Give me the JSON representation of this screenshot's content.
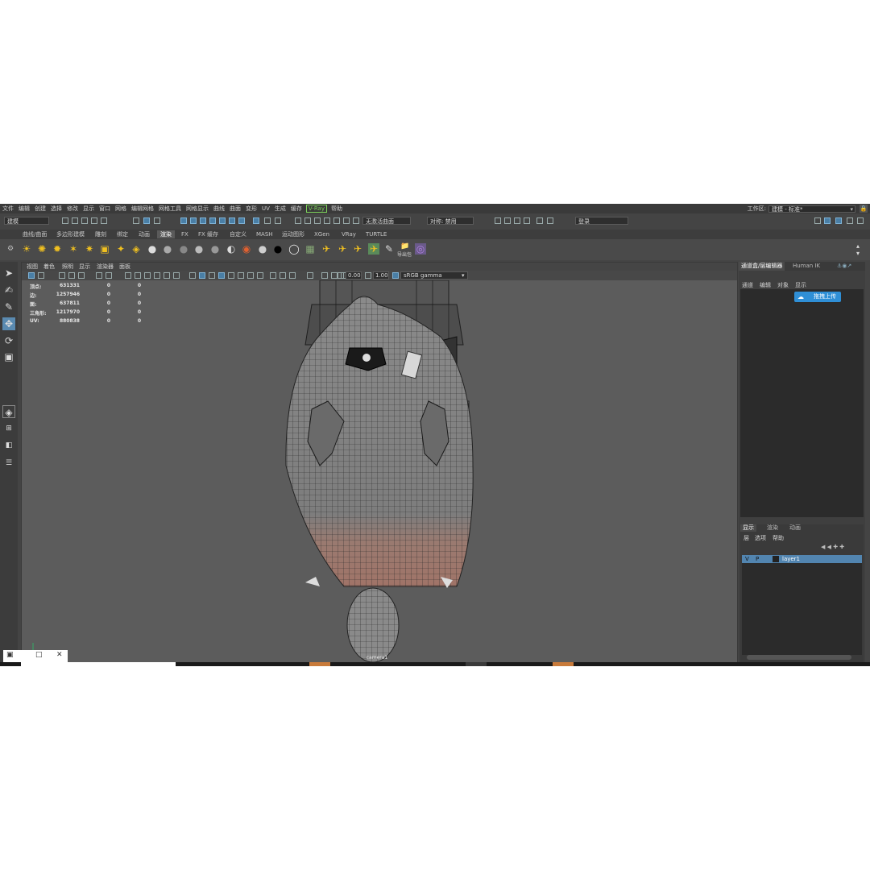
{
  "menu": [
    "文件",
    "编辑",
    "创建",
    "选择",
    "修改",
    "显示",
    "窗口",
    "网格",
    "编辑网格",
    "网格工具",
    "网格显示",
    "曲线",
    "曲面",
    "变形",
    "UV",
    "生成",
    "缓存",
    "V-Ray",
    "帮助"
  ],
  "workspace": {
    "label": "工作区:",
    "value": "建模 - 标准*"
  },
  "status": {
    "mode": "建模",
    "live_surface": "无激活曲面",
    "symmetry": "对称: 禁用",
    "login": "登录"
  },
  "shelf_tabs": [
    "曲线/曲面",
    "多边形建模",
    "雕刻",
    "绑定",
    "动画",
    "渲染",
    "FX",
    "FX 缓存",
    "自定义",
    "MASH",
    "运动图形",
    "XGen",
    "VRay",
    "TURTLE"
  ],
  "shelf_active_tab": "渲染",
  "shelf_label": "导出包",
  "viewport": {
    "menu": [
      "视图",
      "着色",
      "照明",
      "显示",
      "渲染器",
      "面板"
    ],
    "exposure": "0.00",
    "gamma": "1.00",
    "color_space": "sRGB gamma",
    "camera_label": "camera1",
    "hud": [
      {
        "label": "顶点:",
        "v1": "631331",
        "v2": "0",
        "v3": "0"
      },
      {
        "label": "边:",
        "v1": "1257946",
        "v2": "0",
        "v3": "0"
      },
      {
        "label": "面:",
        "v1": "637811",
        "v2": "0",
        "v3": "0"
      },
      {
        "label": "三角形:",
        "v1": "1217970",
        "v2": "0",
        "v3": "0"
      },
      {
        "label": "UV:",
        "v1": "880838",
        "v2": "0",
        "v3": "0"
      }
    ]
  },
  "right_panel": {
    "tabs": [
      "通道盒/层编辑器",
      "Human IK"
    ],
    "menu": [
      "通道",
      "编辑",
      "对象",
      "显示"
    ],
    "upload_button": "拖拽上传",
    "layer_tabs": [
      "显示",
      "渲染",
      "动画"
    ],
    "layer_menu": [
      "层",
      "选项",
      "帮助"
    ],
    "layer": {
      "v": "V",
      "p": "P",
      "name": "layer1"
    }
  },
  "colors": {
    "layer_highlight": "#5285b0",
    "upload": "#2f8fd6",
    "vray": "#7cd35a"
  }
}
